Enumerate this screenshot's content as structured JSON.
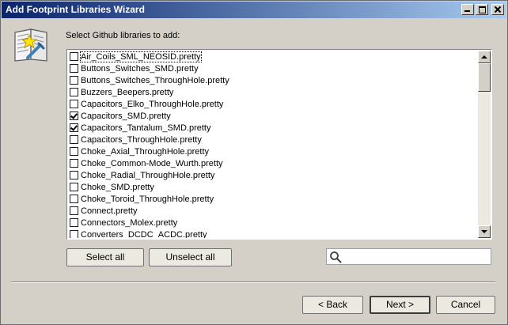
{
  "window": {
    "title": "Add Footprint Libraries Wizard"
  },
  "header": {
    "prompt": "Select Github libraries to add:"
  },
  "libraries": [
    {
      "label": "Air_Coils_SML_NEOSID.pretty",
      "checked": false
    },
    {
      "label": "Buttons_Switches_SMD.pretty",
      "checked": false
    },
    {
      "label": "Buttons_Switches_ThroughHole.pretty",
      "checked": false
    },
    {
      "label": "Buzzers_Beepers.pretty",
      "checked": false
    },
    {
      "label": "Capacitors_Elko_ThroughHole.pretty",
      "checked": false
    },
    {
      "label": "Capacitors_SMD.pretty",
      "checked": true
    },
    {
      "label": "Capacitors_Tantalum_SMD.pretty",
      "checked": true
    },
    {
      "label": "Capacitors_ThroughHole.pretty",
      "checked": false
    },
    {
      "label": "Choke_Axial_ThroughHole.pretty",
      "checked": false
    },
    {
      "label": "Choke_Common-Mode_Wurth.pretty",
      "checked": false
    },
    {
      "label": "Choke_Radial_ThroughHole.pretty",
      "checked": false
    },
    {
      "label": "Choke_SMD.pretty",
      "checked": false
    },
    {
      "label": "Choke_Toroid_ThroughHole.pretty",
      "checked": false
    },
    {
      "label": "Connect.pretty",
      "checked": false
    },
    {
      "label": "Connectors_Molex.pretty",
      "checked": false
    },
    {
      "label": "Converters_DCDC_ACDC.pretty",
      "checked": false
    }
  ],
  "buttons": {
    "select_all": "Select all",
    "unselect_all": "Unselect all",
    "back": "< Back",
    "next": "Next >",
    "cancel": "Cancel"
  },
  "search": {
    "value": "",
    "placeholder": ""
  }
}
